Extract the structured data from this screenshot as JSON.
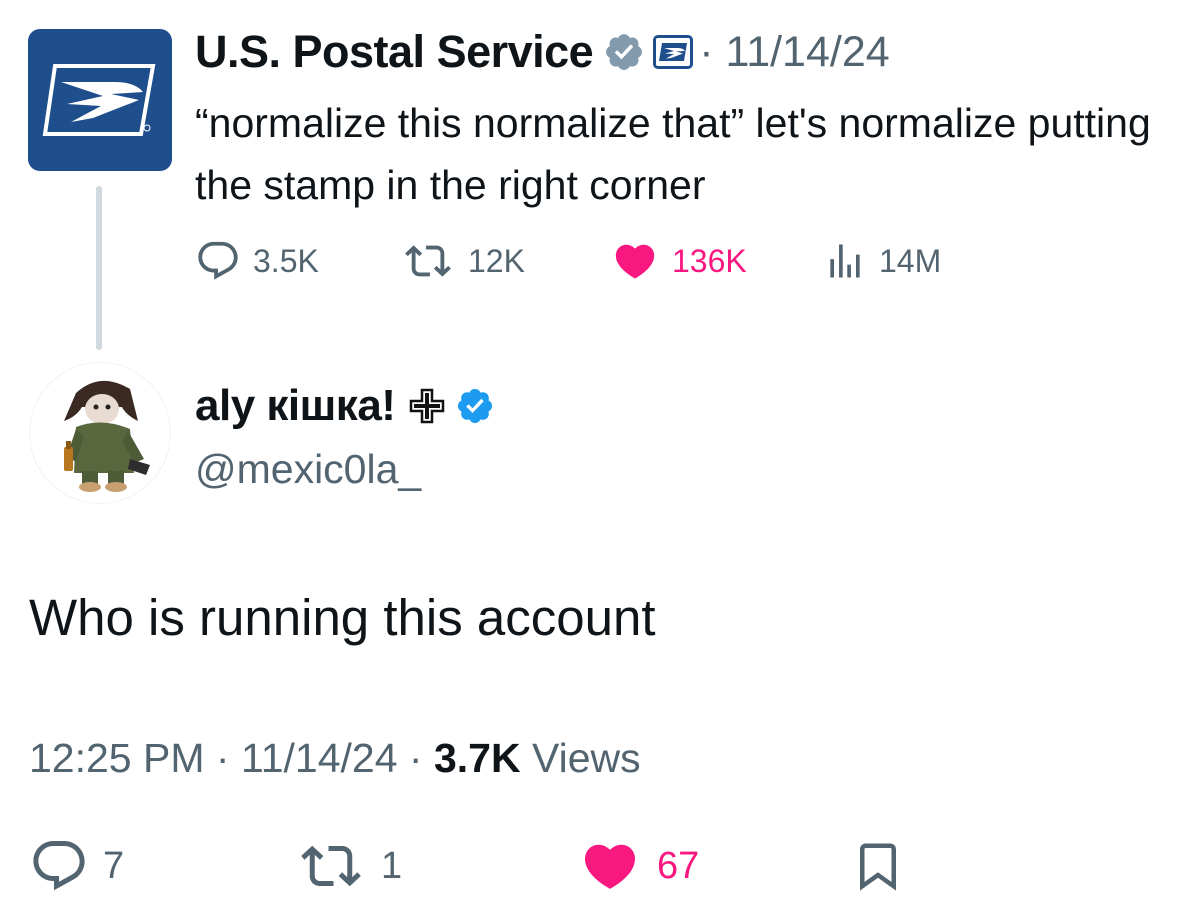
{
  "parent_tweet": {
    "author_name": "U.S. Postal Service",
    "date": "· 11/14/24",
    "text": "“normalize this normalize that” let's normalize putting the stamp in the right corner",
    "actions": {
      "replies": "3.5K",
      "reposts": "12K",
      "likes": "136K",
      "views": "14M"
    }
  },
  "main_tweet": {
    "author_name": "aly кішка!",
    "handle": "@mexic0la_",
    "text": "Who is running this account",
    "time": "12:25 PM",
    "date": "11/14/24",
    "views_count": "3.7K",
    "views_label": "Views",
    "actions": {
      "replies": "7",
      "reposts": "1",
      "likes": "67"
    }
  },
  "colors": {
    "text": "#0f1419",
    "muted": "#536471",
    "like": "#f91880",
    "verified_blue": "#1d9bf0",
    "verified_grey": "#829aab",
    "usps_blue": "#1f4e8c"
  }
}
